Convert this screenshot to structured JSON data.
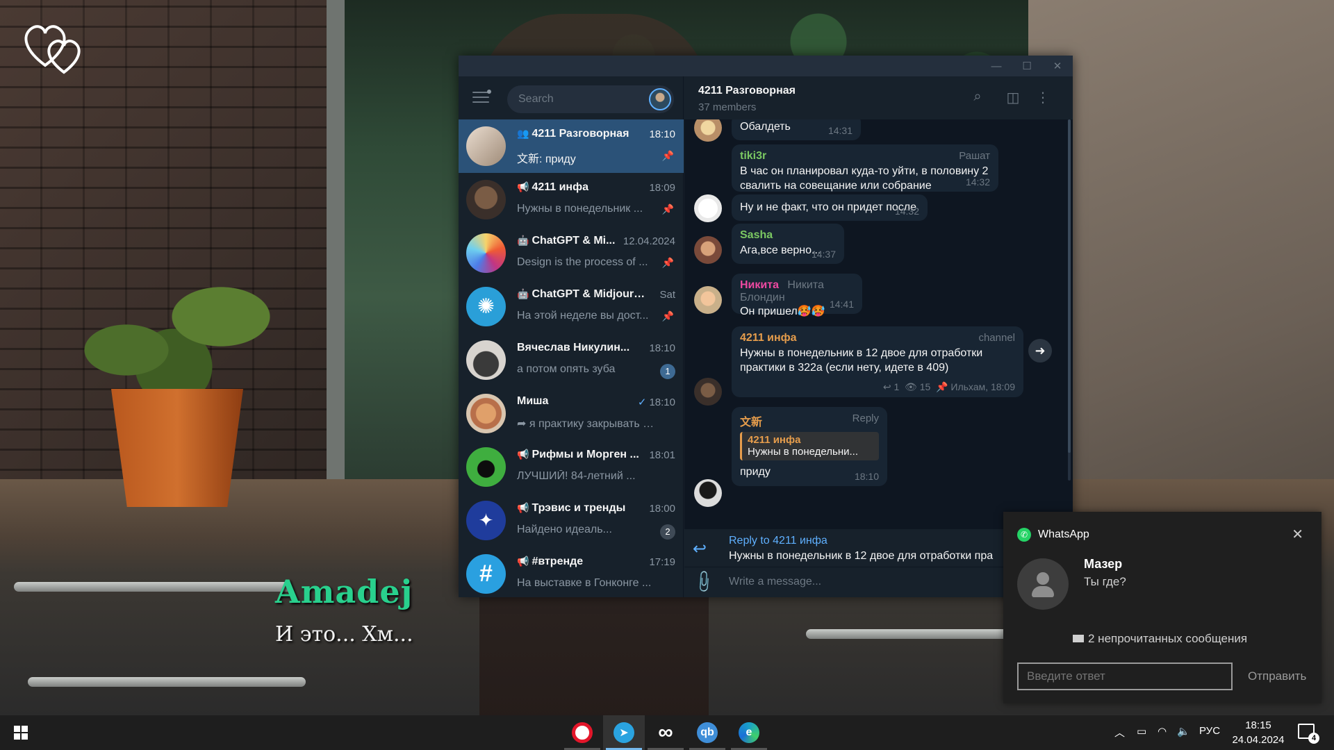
{
  "game": {
    "speaker": "Amadej",
    "line": "И это... Хм..."
  },
  "telegram": {
    "search_placeholder": "Search",
    "chats": [
      {
        "name": "4211 Разговорная",
        "type": "group",
        "time": "18:10",
        "preview": "文新: приду",
        "pinned": true,
        "active": true,
        "avatar_color": "#c8b7a6"
      },
      {
        "name": "4211 инфа",
        "type": "channel",
        "time": "18:09",
        "preview": "Нужны в понедельник ...",
        "pinned": true,
        "avatar_color": "#5a4a3f"
      },
      {
        "name": "ChatGPT & Mi...",
        "type": "bot",
        "time": "12.04.2024",
        "preview": "Design is the process of ...",
        "pinned": true,
        "avatar_color": "#e85a2a"
      },
      {
        "name": "ChatGPT & Midjourn...",
        "type": "bot",
        "time": "Sat",
        "preview": "На этой неделе вы дост...",
        "pinned": true,
        "avatar_color": "#2a9fd8"
      },
      {
        "name": "Вячеслав Никулин...",
        "type": "user",
        "time": "18:10",
        "preview": "а потом опять зуба",
        "badge": "1",
        "avatar_color": "#9a8f88"
      },
      {
        "name": "Миша",
        "type": "user",
        "time": "18:10",
        "preview": "я практику закрывать буду",
        "sent": true,
        "avatar_color": "#c98a5a"
      },
      {
        "name": "Рифмы и Морген ...",
        "type": "channel",
        "time": "18:01",
        "preview": "ЛУЧШИЙ! 84-летний ...",
        "avatar_color": "#2f8f3a"
      },
      {
        "name": "Трэвис и тренды",
        "type": "channel",
        "time": "18:00",
        "preview": "Найдено идеаль...",
        "badge": "2",
        "badge_muted": true,
        "avatar_color": "#1f3c9c"
      },
      {
        "name": "#втренде",
        "type": "channel",
        "time": "17:19",
        "preview": "На выставке в Гонконге ...",
        "avatar_color": "#2aa0e0"
      }
    ],
    "header": {
      "title": "4211 Разговорная",
      "subtitle": "37 members"
    },
    "messages": [
      {
        "text": "Обалдеть",
        "time": "14:31"
      },
      {
        "author": "tiki3r",
        "tag": "Рашат",
        "text": "В час он планировал куда-то уйти, в половину 2 свалить на совещание или собрание",
        "time": "14:32",
        "author_color": "#7bc862"
      },
      {
        "text": "Ну и не факт, что он придет после",
        "time": "14:32"
      },
      {
        "author": "Sasha",
        "text": "Ага,все верно...",
        "time": "14:37",
        "author_color": "#7bc862"
      },
      {
        "author": "Никита",
        "tag": "Никита Блондин",
        "text": "Он пришел🥵🥵",
        "time": "14:41",
        "author_color": "#ee49a1"
      },
      {
        "author": "4211 инфа",
        "tag": "channel",
        "text": "Нужны в понедельник в 12 двое для отработки практики в 322а (если нету, идете в 409)",
        "replies": "1",
        "views": "15",
        "signature": "Ильхам, 18:09",
        "author_color": "#e69d4c"
      },
      {
        "author": "文新",
        "tag": "Reply",
        "quote_author": "4211 инфа",
        "quote_text": "Нужны в понедельни...",
        "text": "приду",
        "time": "18:10",
        "author_color": "#e69d4c"
      }
    ],
    "reply_to": {
      "title": "Reply to 4211 инфа",
      "preview": "Нужны в понедельник в 12 двое для отработки пра"
    },
    "composer_placeholder": "Write a message..."
  },
  "toast": {
    "app": "WhatsApp",
    "sender": "Мазер",
    "message": "Ты где?",
    "unread": "2 непрочитанных сообщения",
    "reply_placeholder": "Введите ответ",
    "send_label": "Отправить"
  },
  "taskbar": {
    "apps": [
      {
        "name": "Opera",
        "color": "#e3162a",
        "glyph": "O"
      },
      {
        "name": "Telegram",
        "color": "#2aa3e0",
        "glyph": "➤",
        "active": true
      },
      {
        "name": "Infinity",
        "color": "#1e1e1e",
        "glyph": "∞"
      },
      {
        "name": "qBittorrent",
        "color": "#3f8ed8",
        "glyph": "qb"
      },
      {
        "name": "Edge",
        "color": "#1aa0c8",
        "glyph": "e"
      }
    ],
    "language": "РУС",
    "time": "18:15",
    "date": "24.04.2024",
    "notifications": "4"
  }
}
